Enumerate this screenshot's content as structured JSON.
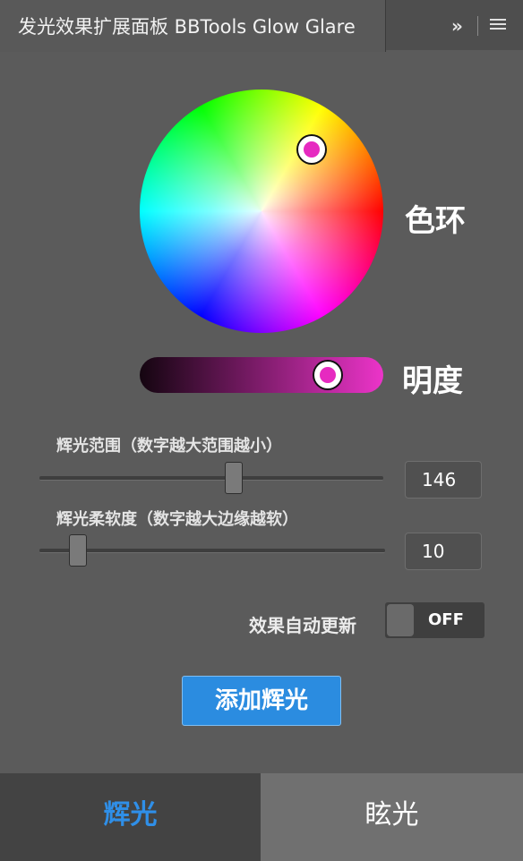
{
  "window": {
    "title": "发光效果扩展面板 BBTools Glow Glare",
    "expand_glyph": "»",
    "menu_icon": "hamburger-menu-icon"
  },
  "color_wheel": {
    "label": "色环",
    "selected_color": "#e62ac0"
  },
  "brightness": {
    "label": "明度",
    "gradient_start": "#140510",
    "gradient_end": "#ec34c9",
    "value_fraction": 0.78
  },
  "sliders": [
    {
      "label": "辉光范围（数字越大范围越小）",
      "value": "146"
    },
    {
      "label": "辉光柔软度（数字越大边缘越软）",
      "value": "10"
    }
  ],
  "auto_update": {
    "label": "效果自动更新",
    "state": "OFF"
  },
  "actions": {
    "add_glow": "添加辉光"
  },
  "tabs": [
    {
      "label": "辉光",
      "active": true
    },
    {
      "label": "眩光",
      "active": false
    }
  ],
  "colors": {
    "accent": "#2b8ce0",
    "panel": "#5b5b5b",
    "active_tab_text": "#2f8fe8"
  }
}
